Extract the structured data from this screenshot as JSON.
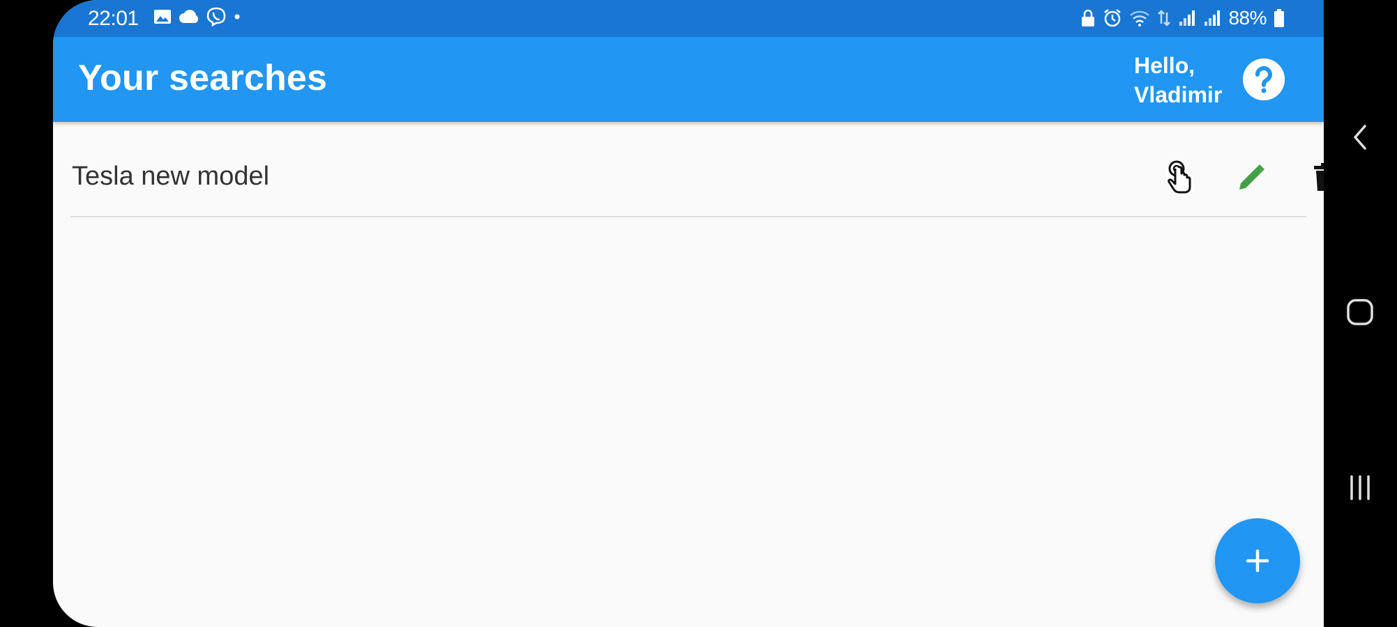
{
  "status_bar": {
    "time": "22:01",
    "battery": "88%",
    "background_color": "#1976d2"
  },
  "app_bar": {
    "title": "Your searches",
    "greeting": "Hello, Vladimir",
    "help_icon": "question-mark-circle-icon",
    "background_color": "#2196f3"
  },
  "searches": [
    {
      "label": "Tesla new model",
      "actions": [
        "touch-icon",
        "edit-pencil-icon",
        "delete-trash-icon"
      ]
    }
  ],
  "fab": {
    "icon": "plus-icon",
    "color": "#2196f3"
  },
  "colors": {
    "edit_icon": "#43a047",
    "delete_icon": "#111111"
  },
  "system_nav": {
    "icons": [
      "back-icon",
      "home-icon",
      "recents-icon"
    ]
  }
}
